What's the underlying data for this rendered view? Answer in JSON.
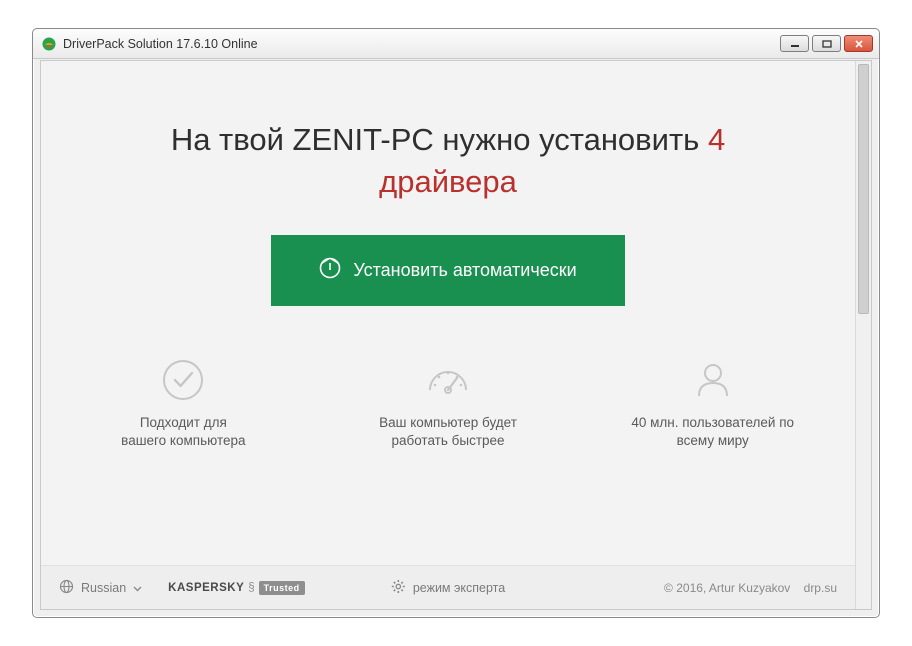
{
  "window": {
    "title": "DriverPack Solution 17.6.10 Online"
  },
  "headline": {
    "prefix": "На твой ",
    "pc_name": "ZENIT-PC",
    "middle": " нужно установить ",
    "count": "4",
    "suffix_line2": "драйвера"
  },
  "cta": {
    "label": "Установить автоматически"
  },
  "features": [
    {
      "line1": "Подходит для",
      "line2": "вашего компьютера"
    },
    {
      "line1": "Ваш компьютер будет",
      "line2": "работать быстрее"
    },
    {
      "line1": "40 млн. пользователей по",
      "line2": "всему миру"
    }
  ],
  "footer": {
    "language": "Russian",
    "kaspersky_brand": "KASPERSKY",
    "trusted_label": "Trusted",
    "expert_mode": "режим эксперта",
    "copyright": "© 2016, Artur Kuzyakov",
    "site": "drp.su"
  }
}
